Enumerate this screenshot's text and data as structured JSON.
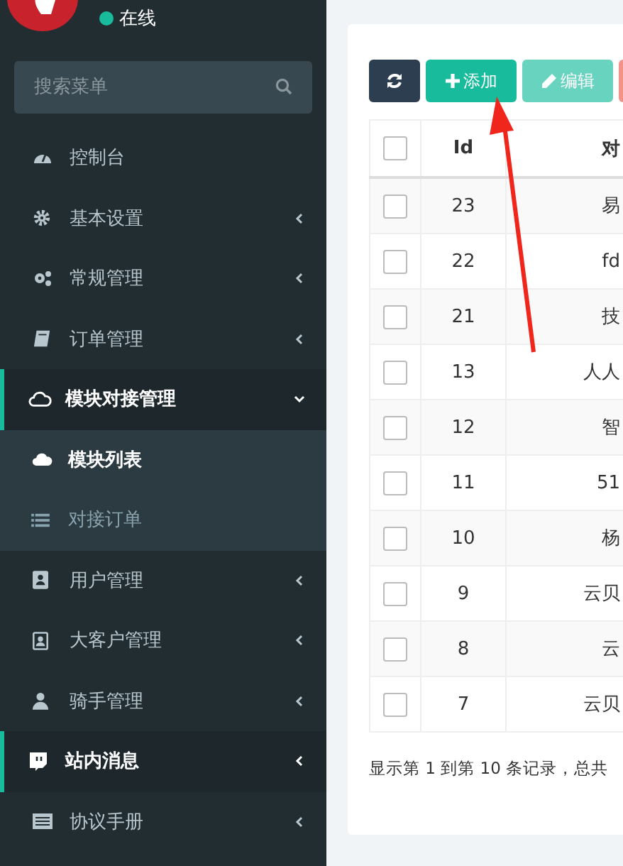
{
  "user": {
    "status": "在线",
    "online": true
  },
  "search": {
    "placeholder": "搜索菜单"
  },
  "menu": [
    {
      "label": "控制台",
      "has_children": false,
      "expanded": false,
      "active": false
    },
    {
      "label": "基本设置",
      "has_children": true,
      "expanded": false,
      "active": false
    },
    {
      "label": "常规管理",
      "has_children": true,
      "expanded": false,
      "active": false
    },
    {
      "label": "订单管理",
      "has_children": true,
      "expanded": false,
      "active": false
    },
    {
      "label": "模块对接管理",
      "has_children": true,
      "expanded": true,
      "active": true,
      "children": [
        {
          "label": "模块列表",
          "selected": true
        },
        {
          "label": "对接订单",
          "selected": false
        }
      ]
    },
    {
      "label": "用户管理",
      "has_children": true,
      "expanded": false,
      "active": false
    },
    {
      "label": "大客户管理",
      "has_children": true,
      "expanded": false,
      "active": false
    },
    {
      "label": "骑手管理",
      "has_children": true,
      "expanded": false,
      "active": false
    },
    {
      "label": "站内消息",
      "has_children": true,
      "expanded": false,
      "active": true
    },
    {
      "label": "协议手册",
      "has_children": true,
      "expanded": false,
      "active": false
    }
  ],
  "toolbar": [
    {
      "kind": "refresh"
    },
    {
      "kind": "add",
      "label": "添加"
    },
    {
      "kind": "edit",
      "label": "编辑",
      "disabled": true
    },
    {
      "kind": "delete"
    }
  ],
  "table": {
    "all_checked": false,
    "columns": [
      "Id",
      "对"
    ],
    "rows": [
      {
        "checked": false,
        "id": "23",
        "column_2": "易"
      },
      {
        "checked": false,
        "id": "22",
        "column_2": "fd"
      },
      {
        "checked": false,
        "id": "21",
        "column_2": "技"
      },
      {
        "checked": false,
        "id": "13",
        "column_2": "人人"
      },
      {
        "checked": false,
        "id": "12",
        "column_2": "智"
      },
      {
        "checked": false,
        "id": "11",
        "column_2": "51"
      },
      {
        "checked": false,
        "id": "10",
        "column_2": "杨"
      },
      {
        "checked": false,
        "id": "9",
        "column_2": "云贝"
      },
      {
        "checked": false,
        "id": "8",
        "column_2": "云"
      },
      {
        "checked": false,
        "id": "7",
        "column_2": "云贝"
      }
    ]
  },
  "pagination_info": "显示第 1 到第 10 条记录，总共"
}
